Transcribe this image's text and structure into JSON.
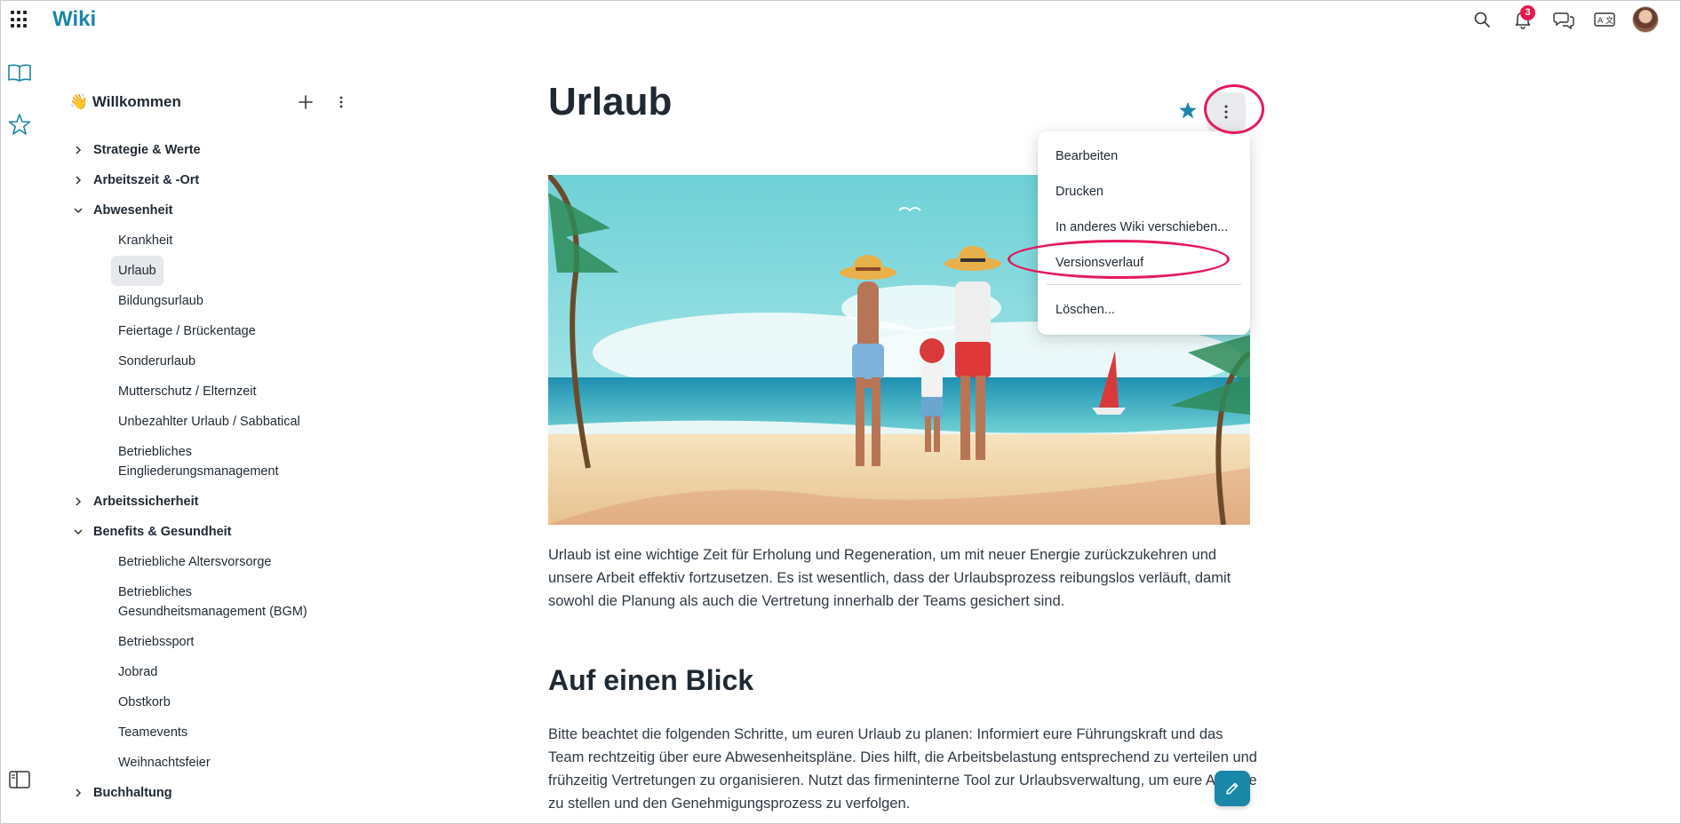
{
  "app": {
    "title": "Wiki",
    "notifications_count": "3",
    "accent_color": "#1a87a8",
    "highlight_color": "#e5195e"
  },
  "topbar_icons": [
    "search-icon",
    "bell-icon",
    "chat-icon",
    "translate-icon",
    "avatar"
  ],
  "rail_icons": [
    "book-icon",
    "star-icon",
    "sidebar-toggle-icon"
  ],
  "sidebar": {
    "root_emoji": "👋",
    "root_label": "Willkommen",
    "items": [
      {
        "label": "Strategie & Werte",
        "expanded": false
      },
      {
        "label": "Arbeitszeit & -Ort",
        "expanded": false
      },
      {
        "label": "Abwesenheit",
        "expanded": true,
        "children": [
          "Krankheit",
          "Urlaub",
          "Bildungsurlaub",
          "Feiertage / Brückentage",
          "Sonderurlaub",
          "Mutterschutz / Elternzeit",
          "Unbezahlter Urlaub / Sabbatical",
          "Betriebliches Eingliederungsmanagement"
        ]
      },
      {
        "label": "Arbeitssicherheit",
        "expanded": false
      },
      {
        "label": "Benefits & Gesundheit",
        "expanded": true,
        "children": [
          "Betriebliche Altersvorsorge",
          "Betriebliches Gesundheitsmanagement (BGM)",
          "Betriebssport",
          "Jobrad",
          "Obstkorb",
          "Teamevents",
          "Weihnachtsfeier"
        ]
      },
      {
        "label": "Buchhaltung",
        "expanded": false
      }
    ],
    "active_item": "Urlaub"
  },
  "page": {
    "title": "Urlaub",
    "paragraph1": "Urlaub ist eine wichtige Zeit für Erholung und Regeneration, um mit neuer Energie zurückzukehren und unsere Arbeit effektiv fortzusetzen. Es ist wesentlich, dass der Urlaubsprozess reibungslos verläuft, damit sowohl die Planung als auch die Vertretung innerhalb der Teams gesichert sind.",
    "heading2": "Auf einen Blick",
    "paragraph2": "Bitte beachtet die folgenden Schritte, um euren Urlaub zu planen: Informiert eure Führungskraft und das Team rechtzeitig über eure Abwesenheitspläne. Dies hilft, die Arbeitsbelastung entsprechend zu verteilen und frühzeitig Vertretungen zu organisieren. Nutzt das firmeninterne Tool zur Urlaubsverwaltung, um eure Anträge zu stellen und den Genehmigungsprozess zu verfolgen."
  },
  "menu": {
    "items": [
      "Bearbeiten",
      "Drucken",
      "In anderes Wiki verschieben...",
      "Versionsverlauf"
    ],
    "danger_items": [
      "Löschen..."
    ]
  }
}
